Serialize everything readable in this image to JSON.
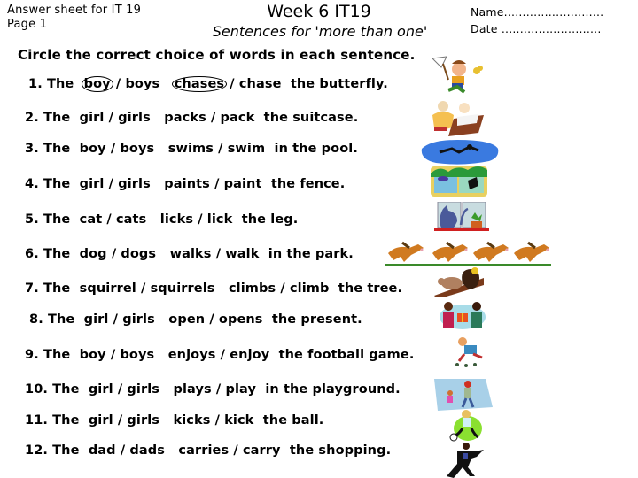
{
  "header": {
    "answer_sheet": "Answer sheet for IT 19",
    "page": "Page 1",
    "title": "Week 6 IT19",
    "subtitle": "Sentences for 'more than one'",
    "name_label": "Name...........................",
    "date_label": "Date ..........................."
  },
  "instruction": "Circle the correct choice of words in each sentence.",
  "sentences": [
    {
      "num": "1.",
      "lead": "The",
      "noun_a": "boy",
      "noun_b": "boys",
      "verb_a": "chases",
      "verb_b": "chase",
      "tail": "the butterfly.",
      "circled": [
        "boy",
        "chases"
      ]
    },
    {
      "num": "2.",
      "lead": "The",
      "noun_a": "girl",
      "noun_b": "girls",
      "verb_a": "packs",
      "verb_b": "pack",
      "tail": "the suitcase."
    },
    {
      "num": "3.",
      "lead": "The",
      "noun_a": "boy",
      "noun_b": "boys",
      "verb_a": "swims",
      "verb_b": "swim",
      "tail": "in the pool."
    },
    {
      "num": "4.",
      "lead": "The",
      "noun_a": "girl",
      "noun_b": "girls",
      "verb_a": "paints",
      "verb_b": "paint",
      "tail": "the fence."
    },
    {
      "num": "5.",
      "lead": "The",
      "noun_a": "cat",
      "noun_b": "cats",
      "verb_a": "licks",
      "verb_b": "lick",
      "tail": "the leg."
    },
    {
      "num": "6.",
      "lead": "The",
      "noun_a": "dog",
      "noun_b": "dogs",
      "verb_a": "walks",
      "verb_b": "walk",
      "tail": "in the park."
    },
    {
      "num": "7.",
      "lead": "The",
      "noun_a": "squirrel",
      "noun_b": "squirrels",
      "verb_a": "climbs",
      "verb_b": "climb",
      "tail": "the tree."
    },
    {
      "num": "8.",
      "lead": "The",
      "noun_a": "girl",
      "noun_b": "girls",
      "verb_a": "open",
      "verb_b": "opens",
      "tail": "the present."
    },
    {
      "num": "9.",
      "lead": "The",
      "noun_a": "boy",
      "noun_b": "boys",
      "verb_a": "enjoys",
      "verb_b": "enjoy",
      "tail": "the football game."
    },
    {
      "num": "10.",
      "lead": "The",
      "noun_a": "girl",
      "noun_b": "girls",
      "verb_a": "plays",
      "verb_b": "play",
      "tail": "in the playground."
    },
    {
      "num": "11.",
      "lead": "The",
      "noun_a": "girl",
      "noun_b": "girls",
      "verb_a": "kicks",
      "verb_b": "kick",
      "tail": "the ball."
    },
    {
      "num": "12.",
      "lead": "The",
      "noun_a": "dad",
      "noun_b": "dads",
      "verb_a": "carries",
      "verb_b": "carry",
      "tail": "the shopping."
    }
  ],
  "separator": "/",
  "images": [
    {
      "name": "boy-chasing-butterfly-image"
    },
    {
      "name": "girl-packing-suitcase-image"
    },
    {
      "name": "boy-swimming-pool-image"
    },
    {
      "name": "girl-painting-fence-image"
    },
    {
      "name": "cat-licking-leg-image"
    },
    {
      "name": "dogs-walking-park-image"
    },
    {
      "name": "squirrel-climbing-tree-image"
    },
    {
      "name": "girls-opening-present-image"
    },
    {
      "name": "boy-football-image"
    },
    {
      "name": "girl-playground-image"
    },
    {
      "name": "girl-kicking-ball-image"
    },
    {
      "name": "dad-carrying-shopping-image"
    }
  ]
}
